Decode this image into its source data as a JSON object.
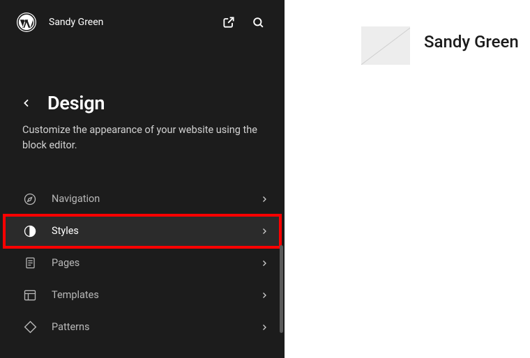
{
  "header": {
    "site_name": "Sandy Green"
  },
  "page": {
    "title": "Design",
    "description": "Customize the appearance of your website using the block editor."
  },
  "nav_items": [
    {
      "label": "Navigation"
    },
    {
      "label": "Styles"
    },
    {
      "label": "Pages"
    },
    {
      "label": "Templates"
    },
    {
      "label": "Patterns"
    }
  ],
  "preview": {
    "site_title": "Sandy Green"
  }
}
